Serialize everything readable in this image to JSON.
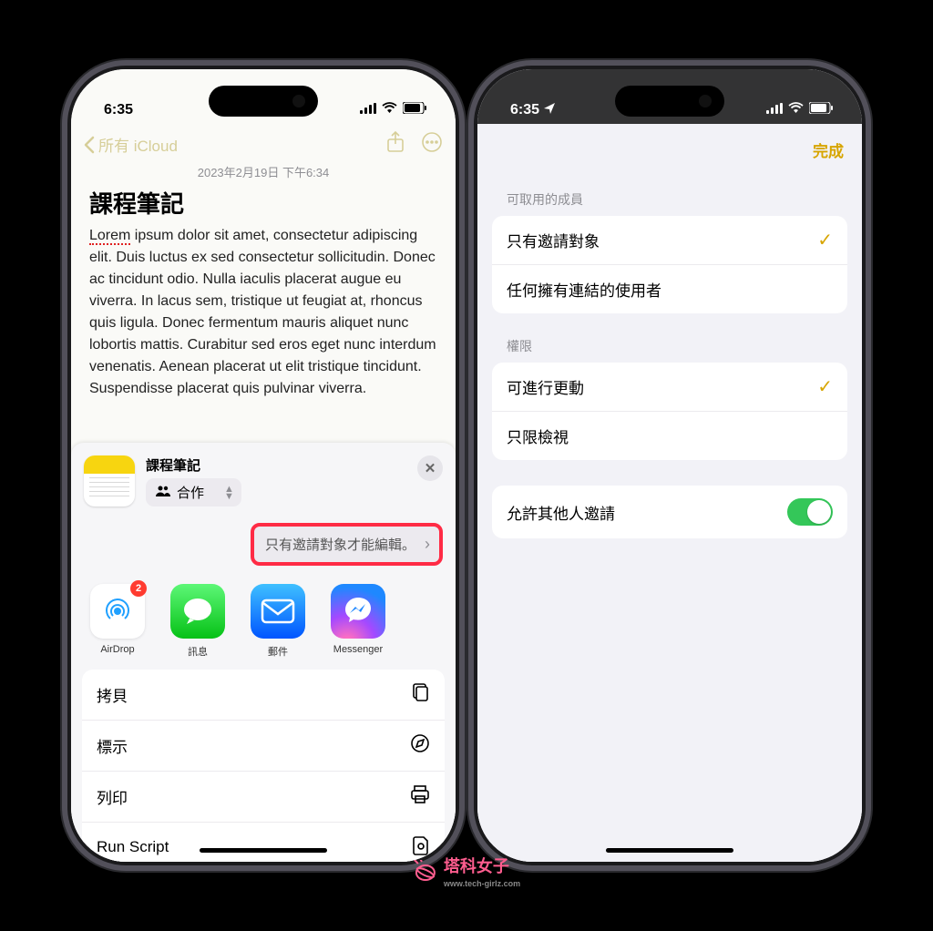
{
  "status_time": "6:35",
  "left": {
    "back_label": "所有 iCloud",
    "note_date": "2023年2月19日 下午6:34",
    "note_title": "課程筆記",
    "note_body_err": "Lorem",
    "note_body_rest": " ipsum dolor sit amet, consectetur adipiscing elit. Duis luctus ex sed consectetur sollicitudin. Donec ac tincidunt odio. Nulla iaculis placerat augue eu viverra. In lacus sem, tristique ut feugiat at, rhoncus quis ligula. Donec fermentum mauris aliquet nunc lobortis mattis. Curabitur sed eros eget nunc interdum venenatis. Aenean placerat ut elit tristique tincidunt. Suspendisse placerat quis pulvinar viverra.",
    "share": {
      "title": "課程筆記",
      "collab_label": "合作",
      "permission_label": "只有邀請對象才能編輯。",
      "apps": {
        "airdrop": "AirDrop",
        "airdrop_badge": "2",
        "messages": "訊息",
        "mail": "郵件",
        "messenger": "Messenger"
      },
      "actions": {
        "copy": "拷貝",
        "markup": "標示",
        "print": "列印",
        "run_script": "Run Script"
      }
    }
  },
  "right": {
    "done": "完成",
    "section1_title": "可取用的成員",
    "opt_invite": "只有邀請對象",
    "opt_link": "任何擁有連結的使用者",
    "section2_title": "權限",
    "perm_edit": "可進行更動",
    "perm_view": "只限檢視",
    "allow_others": "允許其他人邀請"
  },
  "watermark": {
    "brand": "塔科女子",
    "url": "www.tech-girlz.com"
  }
}
